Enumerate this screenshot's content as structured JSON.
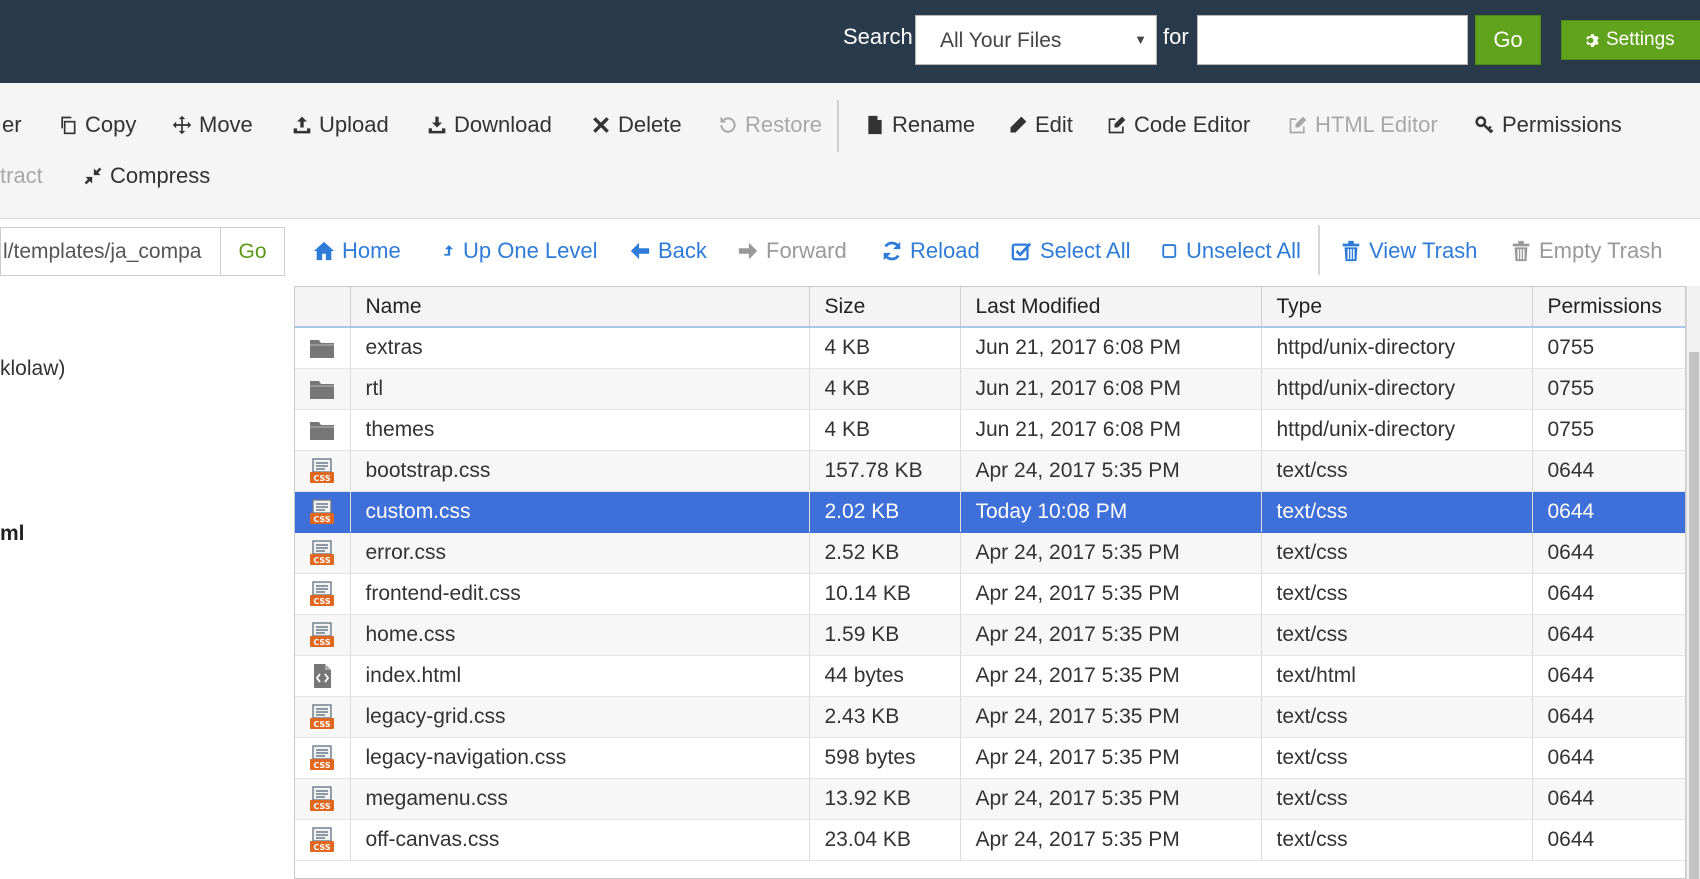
{
  "header": {
    "search_label": "Search",
    "search_scope": "All Your Files",
    "for_label": "for",
    "search_value": "",
    "go_label": "Go",
    "settings_label": "Settings"
  },
  "toolbar": {
    "row1": [
      {
        "label": "er",
        "icon": "new-folder-icon",
        "disabled": false
      },
      {
        "label": "Copy",
        "icon": "copy-icon",
        "disabled": false
      },
      {
        "label": "Move",
        "icon": "move-icon",
        "disabled": false
      },
      {
        "label": "Upload",
        "icon": "upload-icon",
        "disabled": false
      },
      {
        "label": "Download",
        "icon": "download-icon",
        "disabled": false
      },
      {
        "label": "Delete",
        "icon": "delete-icon",
        "disabled": false
      },
      {
        "label": "Restore",
        "icon": "restore-icon",
        "disabled": true
      },
      {
        "label": "Rename",
        "icon": "rename-icon",
        "disabled": false
      },
      {
        "label": "Edit",
        "icon": "edit-icon",
        "disabled": false
      },
      {
        "label": "Code Editor",
        "icon": "code-editor-icon",
        "disabled": false
      },
      {
        "label": "HTML Editor",
        "icon": "html-editor-icon",
        "disabled": true
      },
      {
        "label": "Permissions",
        "icon": "permissions-icon",
        "disabled": false
      }
    ],
    "row2": [
      {
        "label": "tract",
        "icon": "extract-icon",
        "disabled": true
      },
      {
        "label": "Compress",
        "icon": "compress-icon",
        "disabled": false
      }
    ]
  },
  "nav": {
    "path_value": "l/templates/ja_compa",
    "go_label": "Go",
    "items": [
      {
        "label": "Home",
        "icon": "home-icon",
        "disabled": false
      },
      {
        "label": "Up One Level",
        "icon": "up-level-icon",
        "disabled": false
      },
      {
        "label": "Back",
        "icon": "back-arrow-icon",
        "disabled": false
      },
      {
        "label": "Forward",
        "icon": "forward-arrow-icon",
        "disabled": true
      },
      {
        "label": "Reload",
        "icon": "reload-icon",
        "disabled": false
      },
      {
        "label": "Select All",
        "icon": "select-all-icon",
        "disabled": false
      },
      {
        "label": "Unselect All",
        "icon": "unselect-all-icon",
        "disabled": false
      },
      {
        "label": "View Trash",
        "icon": "trash-icon",
        "disabled": false
      },
      {
        "label": "Empty Trash",
        "icon": "empty-trash-icon",
        "disabled": true
      }
    ]
  },
  "tree": {
    "item1": "klolaw)",
    "item2": "ml"
  },
  "table": {
    "columns": [
      "",
      "Name",
      "Size",
      "Last Modified",
      "Type",
      "Permissions"
    ],
    "rows": [
      {
        "icon": "folder-icon",
        "name": "extras",
        "size": "4 KB",
        "modified": "Jun 21, 2017 6:08 PM",
        "type": "httpd/unix-directory",
        "perms": "0755",
        "selected": false
      },
      {
        "icon": "folder-icon",
        "name": "rtl",
        "size": "4 KB",
        "modified": "Jun 21, 2017 6:08 PM",
        "type": "httpd/unix-directory",
        "perms": "0755",
        "selected": false
      },
      {
        "icon": "folder-icon",
        "name": "themes",
        "size": "4 KB",
        "modified": "Jun 21, 2017 6:08 PM",
        "type": "httpd/unix-directory",
        "perms": "0755",
        "selected": false
      },
      {
        "icon": "css-file-icon",
        "name": "bootstrap.css",
        "size": "157.78 KB",
        "modified": "Apr 24, 2017 5:35 PM",
        "type": "text/css",
        "perms": "0644",
        "selected": false
      },
      {
        "icon": "css-file-icon",
        "name": "custom.css",
        "size": "2.02 KB",
        "modified": "Today 10:08 PM",
        "type": "text/css",
        "perms": "0644",
        "selected": true
      },
      {
        "icon": "css-file-icon",
        "name": "error.css",
        "size": "2.52 KB",
        "modified": "Apr 24, 2017 5:35 PM",
        "type": "text/css",
        "perms": "0644",
        "selected": false
      },
      {
        "icon": "css-file-icon",
        "name": "frontend-edit.css",
        "size": "10.14 KB",
        "modified": "Apr 24, 2017 5:35 PM",
        "type": "text/css",
        "perms": "0644",
        "selected": false
      },
      {
        "icon": "css-file-icon",
        "name": "home.css",
        "size": "1.59 KB",
        "modified": "Apr 24, 2017 5:35 PM",
        "type": "text/css",
        "perms": "0644",
        "selected": false
      },
      {
        "icon": "html-file-icon",
        "name": "index.html",
        "size": "44 bytes",
        "modified": "Apr 24, 2017 5:35 PM",
        "type": "text/html",
        "perms": "0644",
        "selected": false
      },
      {
        "icon": "css-file-icon",
        "name": "legacy-grid.css",
        "size": "2.43 KB",
        "modified": "Apr 24, 2017 5:35 PM",
        "type": "text/css",
        "perms": "0644",
        "selected": false
      },
      {
        "icon": "css-file-icon",
        "name": "legacy-navigation.css",
        "size": "598 bytes",
        "modified": "Apr 24, 2017 5:35 PM",
        "type": "text/css",
        "perms": "0644",
        "selected": false
      },
      {
        "icon": "css-file-icon",
        "name": "megamenu.css",
        "size": "13.92 KB",
        "modified": "Apr 24, 2017 5:35 PM",
        "type": "text/css",
        "perms": "0644",
        "selected": false
      },
      {
        "icon": "css-file-icon",
        "name": "off-canvas.css",
        "size": "23.04 KB",
        "modified": "Apr 24, 2017 5:35 PM",
        "type": "text/css",
        "perms": "0644",
        "selected": false
      }
    ]
  },
  "colors": {
    "header_bg": "#293a4a",
    "go_green": "#61a31c",
    "link_blue": "#2f7cd8",
    "selection_blue": "#3f6fd9"
  }
}
